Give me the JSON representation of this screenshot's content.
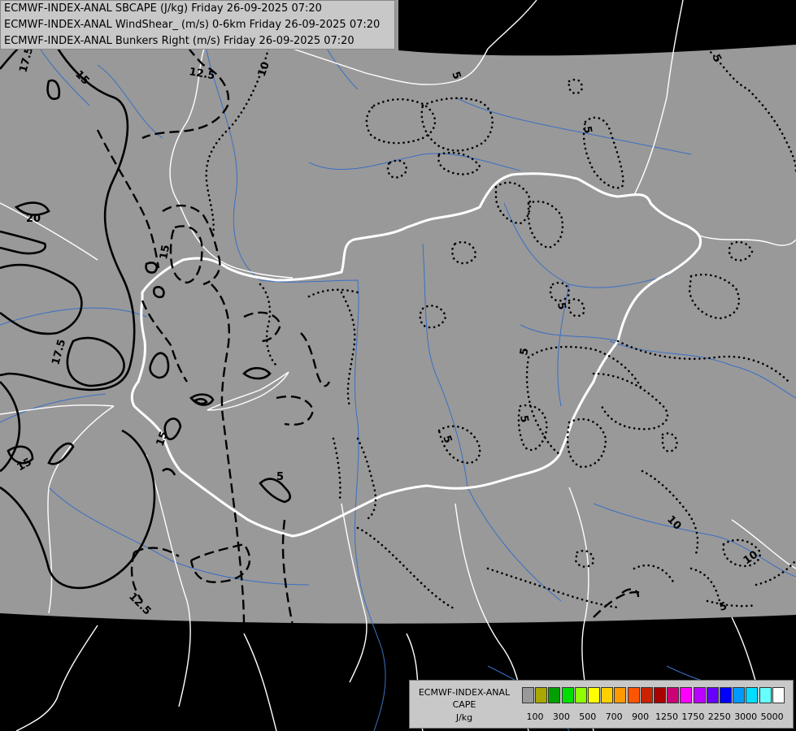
{
  "header": {
    "line1": "ECMWF-INDEX-ANAL SBCAPE (J/kg) Friday 26-09-2025 07:20",
    "line2": "ECMWF-INDEX-ANAL WindShear_ (m/s) 0-6km Friday 26-09-2025 07:20",
    "line3": "ECMWF-INDEX-ANAL Bunkers Right (m/s) Friday 26-09-2025 07:20"
  },
  "legend": {
    "title1": "ECMWF-INDEX-ANAL",
    "title2": "CAPE",
    "title3": "J/kg",
    "colors": [
      "#999999",
      "#a8a800",
      "#00a000",
      "#00e000",
      "#90ff00",
      "#ffff00",
      "#ffd000",
      "#ff9900",
      "#ff5500",
      "#cc2200",
      "#aa0000",
      "#cc0077",
      "#ff00ff",
      "#bb00ff",
      "#6600ff",
      "#0000ff",
      "#0099ff",
      "#00ddff",
      "#66ffff",
      "#ffffff"
    ],
    "ticks": [
      "100",
      "300",
      "500",
      "700",
      "900",
      "1250",
      "1750",
      "2250",
      "3000",
      "5000"
    ]
  },
  "map": {
    "colors": {
      "data_area": "#999999",
      "outside": "#000000",
      "borders": "#ffffff",
      "rivers": "#3a6fc4",
      "contours": "#000000"
    },
    "solid_contour_labels": [
      "17.5",
      "15",
      "12.5",
      "20",
      "17.5",
      "15",
      "15"
    ],
    "dashed_contour_labels": [
      "12.5",
      "15",
      "12.5",
      "5"
    ],
    "dotted_contour_labels": [
      "10",
      "5",
      "5",
      "5",
      "5",
      "5",
      "5",
      "5",
      "10",
      "10",
      "5"
    ]
  }
}
